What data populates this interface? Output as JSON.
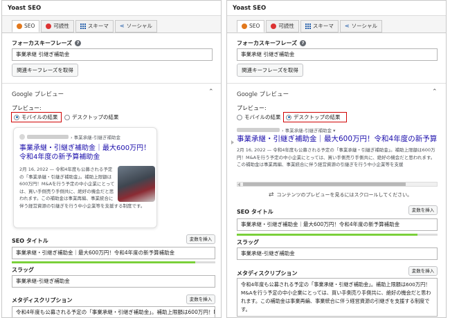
{
  "panel_title": "Yoast SEO",
  "tabs": [
    {
      "label": "SEO",
      "icon": "orange-dot-icon"
    },
    {
      "label": "可読性",
      "icon": "red-face-icon"
    },
    {
      "label": "スキーマ",
      "icon": "grid-icon"
    },
    {
      "label": "ソーシャル",
      "icon": "share-icon"
    }
  ],
  "focus_keyphrase": {
    "label": "フォーカスキーフレーズ",
    "value": "事業承継 引継ぎ補助金",
    "button": "関連キーフレーズを取得"
  },
  "google_preview": {
    "title": "Google プレビュー",
    "preview_label": "プレビュー:",
    "mobile_option": "モバイルの結果",
    "desktop_option": "デスクトップの結果",
    "breadcrumb": "› 事業承継-引継ぎ補助金",
    "breadcrumb_desktop": "› 事業承継-引継ぎ補助金 ▾",
    "serp_title_mobile": "事業承継・引継ぎ補助金｜最大600万円！令和4年度の新予算補助金",
    "serp_title_desktop": "事業承継・引継ぎ補助金｜最大600万円！令和4年度の新予算",
    "serp_desc_mobile": "2月 16, 2022 — 令和4年度も公募される予定の「事業承継・引継ぎ補助金」。補助上限額は600万円！M&Aを行う予定の中小企業にとっては、買い手側売り手側共に、絶好の機会だと思われます。この補助金は事業再編、事業統合に伴う経営資源の引継ぎを行う中小企業等を支援する制度です。",
    "serp_desc_desktop": "2月 16, 2022 — 令和4年度も公募される予定の「事業承継・引継ぎ補助金」。補助上限額は600万円！M&Aを行う予定の中小企業にとっては、買い手側売り手側共に、絶好の機会だと思われます。この補助金は事業再編、事業統合に伴う経営資源の引継ぎを行う中小企業等を支援",
    "scroll_hint": "コンテンツのプレビューを見るにはスクロールしてください。"
  },
  "seo_title": {
    "label": "SEO タイトル",
    "insert_button": "変数を挿入",
    "value": "事業承継・引継ぎ補助金｜最大600万円！令和4年度の新予算補助金",
    "progress": 0.9
  },
  "slug": {
    "label": "スラッグ",
    "value": "事業承継-引継ぎ補助金"
  },
  "meta_description": {
    "label": "メタディスクリプション",
    "insert_button": "変数を挿入",
    "value_left": "令和4年度も公募される予定の「事業承継・引継ぎ補助金」。補助上限額は600万円！M",
    "value_right": "令和4年度も公募される予定の「事業承継・引継ぎ補助金」。補助上限額は600万円！M&Aを行う予定の中小企業にとっては、買い手側売り手側共に、絶好の機会だと思われます。この補助金は事業再編、事業統合に伴う経営資源の引継ぎを支援する制度です。"
  },
  "colors": {
    "link": "#1a0dab",
    "highlight": "#d00000",
    "progress": "#7ad03a"
  }
}
